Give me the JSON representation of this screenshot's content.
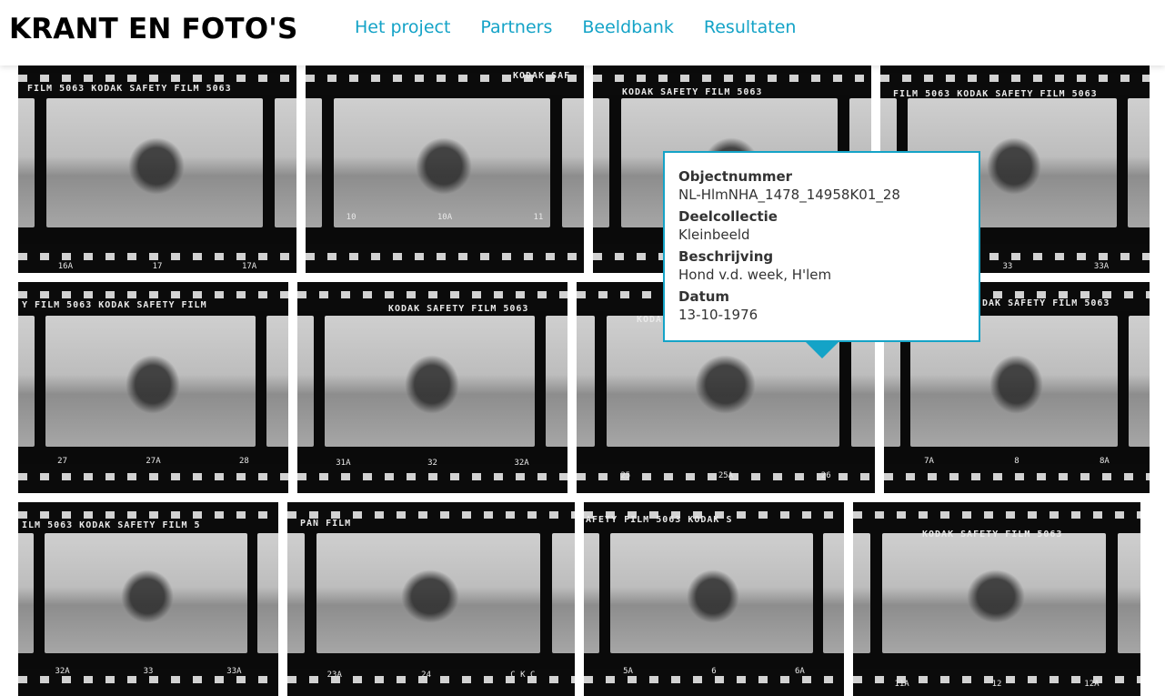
{
  "site": {
    "logo": "KRANT EN FOTO'S",
    "brand_color": "#14a3c7"
  },
  "nav": {
    "items": [
      {
        "label": "Het project"
      },
      {
        "label": "Partners"
      },
      {
        "label": "Beeldbank"
      },
      {
        "label": "Resultaten"
      }
    ]
  },
  "thumbnails": [
    {
      "edge": "FILM 5063    KODAK SAFETY FILM 5063",
      "numbers": [
        "16A",
        "17",
        "17A"
      ]
    },
    {
      "edge": "KODAK SAF",
      "numbers": [
        "10",
        "10A",
        "11"
      ]
    },
    {
      "edge": "KODAK SAFETY FILM 5063",
      "numbers": [
        "",
        "",
        ""
      ]
    },
    {
      "edge": "FILM 5063    KODAK SAFETY FILM 5063",
      "numbers": [
        "",
        "33",
        "33A"
      ]
    },
    {
      "edge": "Y FILM 5063    KODAK SAFETY FILM",
      "numbers": [
        "27",
        "27A",
        "28"
      ]
    },
    {
      "edge": "KODAK SAFETY FILM 5063",
      "numbers": [
        "31A",
        "32",
        "32A"
      ]
    },
    {
      "edge": "KODA",
      "numbers": [
        "25",
        "25A",
        "26"
      ]
    },
    {
      "edge": "DAK SAFETY FILM 5063",
      "numbers": [
        "7A",
        "8",
        "8A"
      ]
    },
    {
      "edge": "ILM 5063    KODAK SAFETY FILM 5",
      "numbers": [
        "32A",
        "33",
        "33A"
      ]
    },
    {
      "edge": "PAN FILM",
      "numbers": [
        "23A",
        "24",
        "C K C"
      ]
    },
    {
      "edge": "AFETY FILM 5063    KODAK S",
      "numbers": [
        "5A",
        "6",
        "6A"
      ]
    },
    {
      "edge": "KODAK SAFETY FILM 5063",
      "numbers": [
        "11A",
        "12",
        "12A"
      ]
    }
  ],
  "tooltip": {
    "objectnummer_label": "Objectnummer",
    "objectnummer_value": "NL-HlmNHA_1478_14958K01_28",
    "deelcollectie_label": "Deelcollectie",
    "deelcollectie_value": "Kleinbeeld",
    "beschrijving_label": "Beschrijving",
    "beschrijving_value": "Hond v.d. week, H'lem",
    "datum_label": "Datum",
    "datum_value": "13-10-1976"
  }
}
